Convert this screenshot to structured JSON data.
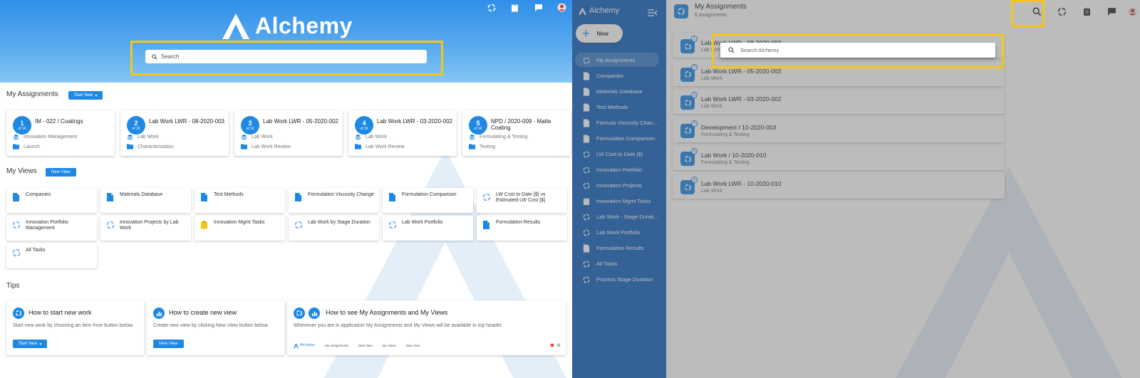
{
  "left": {
    "top_icons": [
      "assignments-icon",
      "clipboard-icon",
      "chat-icon",
      "avatar"
    ],
    "brand": "Alchemy",
    "search_placeholder": "Search",
    "assignments": {
      "title": "My Assignments",
      "button": "Start New",
      "cards": [
        {
          "num": "1",
          "of": "of 16",
          "title": "IM - 022 / Coatings",
          "type": "Innovation Management",
          "stage": "Launch"
        },
        {
          "num": "2",
          "of": "of 16",
          "title": "Lab Work LWR - 08-2020-003",
          "type": "Lab Work",
          "stage": "Characterization"
        },
        {
          "num": "3",
          "of": "of 16",
          "title": "Lab Work LWR - 05-2020-002",
          "type": "Lab Work",
          "stage": "Lab Work Review"
        },
        {
          "num": "4",
          "of": "of 16",
          "title": "Lab Work LWR - 03-2020-002",
          "type": "Lab Work",
          "stage": "Lab Work Review"
        },
        {
          "num": "5",
          "of": "of 16",
          "title": "NPD / 2020-009 - Matte Coating",
          "type": "Formulating & Testing",
          "stage": "Testing"
        }
      ]
    },
    "views": {
      "title": "My Views",
      "button": "New View",
      "items": [
        {
          "label": "Companies",
          "icon": "doc"
        },
        {
          "label": "Materials Database",
          "icon": "doc"
        },
        {
          "label": "Test Methods",
          "icon": "doc"
        },
        {
          "label": "Formulation Viscosity Change",
          "icon": "doc"
        },
        {
          "label": "Formulation Comparison",
          "icon": "doc"
        },
        {
          "label": "LW Cost to Date [$] vs Estimated LW Cost [$]",
          "icon": "cycle"
        },
        {
          "label": "Innovation Portfolio Management",
          "icon": "cycle"
        },
        {
          "label": "Innovation Projects by Lab Work",
          "icon": "cycle"
        },
        {
          "label": "Innovation Mgmt Tasks",
          "icon": "clip"
        },
        {
          "label": "Lab Work by Stage Duration",
          "icon": "cycle"
        },
        {
          "label": "Lab Work Portfolio",
          "icon": "cycle"
        },
        {
          "label": "Formulation Results",
          "icon": "doc"
        },
        {
          "label": "All Tasks",
          "icon": "cycle"
        }
      ]
    },
    "tips": {
      "title": "Tips",
      "cards": [
        {
          "title": "How to start new work",
          "desc": "Start new work by choosing an item from button below.",
          "button": "Start New"
        },
        {
          "title": "How to create new view",
          "desc": "Create new view by clicking New View button below.",
          "button": "New View"
        },
        {
          "title": "How to see My Assignments and My Views",
          "desc": "Whenever you are in application My Assignments and My Views will be available in top header."
        }
      ],
      "mini_header": {
        "brand": "Alchemy",
        "items": [
          "My Assignments",
          "Start New",
          "My Views",
          "New View"
        ]
      }
    }
  },
  "right": {
    "brand": "Alchemy",
    "new_button": "New",
    "sidebar": [
      {
        "label": "My Assignments",
        "icon": "cycle",
        "active": true
      },
      {
        "label": "Companies",
        "icon": "doc"
      },
      {
        "label": "Materials Database",
        "icon": "doc"
      },
      {
        "label": "Test Methods",
        "icon": "doc"
      },
      {
        "label": "Formula Viscosity Chan...",
        "icon": "doc"
      },
      {
        "label": "Formulation Comparison",
        "icon": "doc"
      },
      {
        "label": "LW Cost to Date [$]",
        "icon": "cycle"
      },
      {
        "label": "Innovation Portfolio",
        "icon": "cycle"
      },
      {
        "label": "Innovation Projects",
        "icon": "cycle"
      },
      {
        "label": "Innovation Mgmt Tasks",
        "icon": "clip"
      },
      {
        "label": "Lab Work - Stage Durati...",
        "icon": "cycle"
      },
      {
        "label": "Lab Work Portfolio",
        "icon": "cycle"
      },
      {
        "label": "Formulation Results",
        "icon": "doc"
      },
      {
        "label": "All Tasks",
        "icon": "cycle"
      },
      {
        "label": "Process Stage Duration",
        "icon": "cycle"
      }
    ],
    "header": {
      "title": "My Assignments",
      "subtitle": "6 assignments"
    },
    "header_icons": [
      "search-icon",
      "assignments-icon",
      "clipboard-icon",
      "chat-icon",
      "avatar"
    ],
    "list": [
      {
        "num": "1",
        "title": "Lab Work LWR - 08-2020-003",
        "sub": "Lab Work"
      },
      {
        "num": "2",
        "title": "Lab Work LWR - 05-2020-002",
        "sub": "Lab Work"
      },
      {
        "num": "3",
        "title": "Lab Work LWR - 03-2020-002",
        "sub": "Lab Work"
      },
      {
        "num": "4",
        "title": "Development / 10-2020-003",
        "sub": "Formulating & Testing"
      },
      {
        "num": "5",
        "title": "Lab Work / 10-2020-010",
        "sub": "Formulating & Testing"
      },
      {
        "num": "6",
        "title": "Lab Work LWR - 10-2020-010",
        "sub": "Lab Work"
      }
    ],
    "search_placeholder": "Search Alchemy"
  },
  "colors": {
    "primary": "#1e88e5",
    "sidebar": "#1565c0",
    "highlight": "#f5c518"
  }
}
